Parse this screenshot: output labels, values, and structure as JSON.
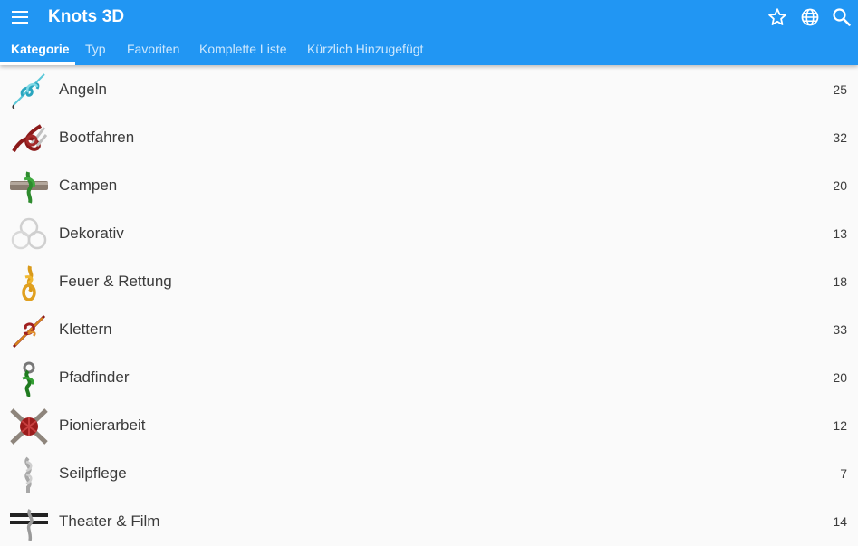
{
  "app": {
    "title": "Knots 3D",
    "colors": {
      "primary": "#2196f3",
      "on_primary": "#ffffff",
      "text": "#3c3c3c",
      "background": "#fafafa"
    }
  },
  "toolbar": {
    "icons": {
      "menu": "menu-icon",
      "favorites": "star-icon",
      "language": "globe-icon",
      "search": "search-icon"
    }
  },
  "tabs": [
    {
      "label": "Kategorie",
      "active": true
    },
    {
      "label": "Typ",
      "active": false
    },
    {
      "label": "Favoriten",
      "active": false
    },
    {
      "label": "Komplette Liste",
      "active": false
    },
    {
      "label": "Kürzlich Hinzugefügt",
      "active": false
    }
  ],
  "categories": [
    {
      "name": "Angeln",
      "count": "25",
      "icon": "fishing-knot-icon"
    },
    {
      "name": "Bootfahren",
      "count": "32",
      "icon": "boating-knot-icon"
    },
    {
      "name": "Campen",
      "count": "20",
      "icon": "camping-knot-icon"
    },
    {
      "name": "Dekorativ",
      "count": "13",
      "icon": "decorative-knot-icon"
    },
    {
      "name": "Feuer & Rettung",
      "count": "18",
      "icon": "fire-rescue-knot-icon"
    },
    {
      "name": "Klettern",
      "count": "33",
      "icon": "climbing-knot-icon"
    },
    {
      "name": "Pfadfinder",
      "count": "20",
      "icon": "scouting-knot-icon"
    },
    {
      "name": "Pionierarbeit",
      "count": "12",
      "icon": "pioneering-knot-icon"
    },
    {
      "name": "Seilpflege",
      "count": "7",
      "icon": "rope-care-knot-icon"
    },
    {
      "name": "Theater & Film",
      "count": "14",
      "icon": "theater-film-knot-icon"
    }
  ]
}
